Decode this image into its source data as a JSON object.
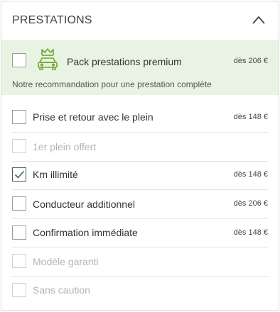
{
  "header": {
    "title": "PRESTATIONS"
  },
  "premium": {
    "label": "Pack prestations premium",
    "price": "dès 206 €",
    "recommendation": "Notre recommandation pour une prestation complète"
  },
  "options": [
    {
      "label": "Prise et retour avec le plein",
      "price": "dès 148 €",
      "checked": false,
      "disabled": false
    },
    {
      "label": "1er plein offert",
      "price": "",
      "checked": false,
      "disabled": true
    },
    {
      "label": "Km illimité",
      "price": "dès 148 €",
      "checked": true,
      "disabled": false
    },
    {
      "label": "Conducteur additionnel",
      "price": "dès 206 €",
      "checked": false,
      "disabled": false
    },
    {
      "label": "Confirmation immédiate",
      "price": "dès 148 €",
      "checked": false,
      "disabled": false
    },
    {
      "label": "Modèle garanti",
      "price": "",
      "checked": false,
      "disabled": true
    },
    {
      "label": "Sans caution",
      "price": "",
      "checked": false,
      "disabled": true
    }
  ],
  "colors": {
    "accent": "#5a9e2e",
    "premium_bg": "#e8f3e4",
    "check": "#2e6b5a"
  }
}
